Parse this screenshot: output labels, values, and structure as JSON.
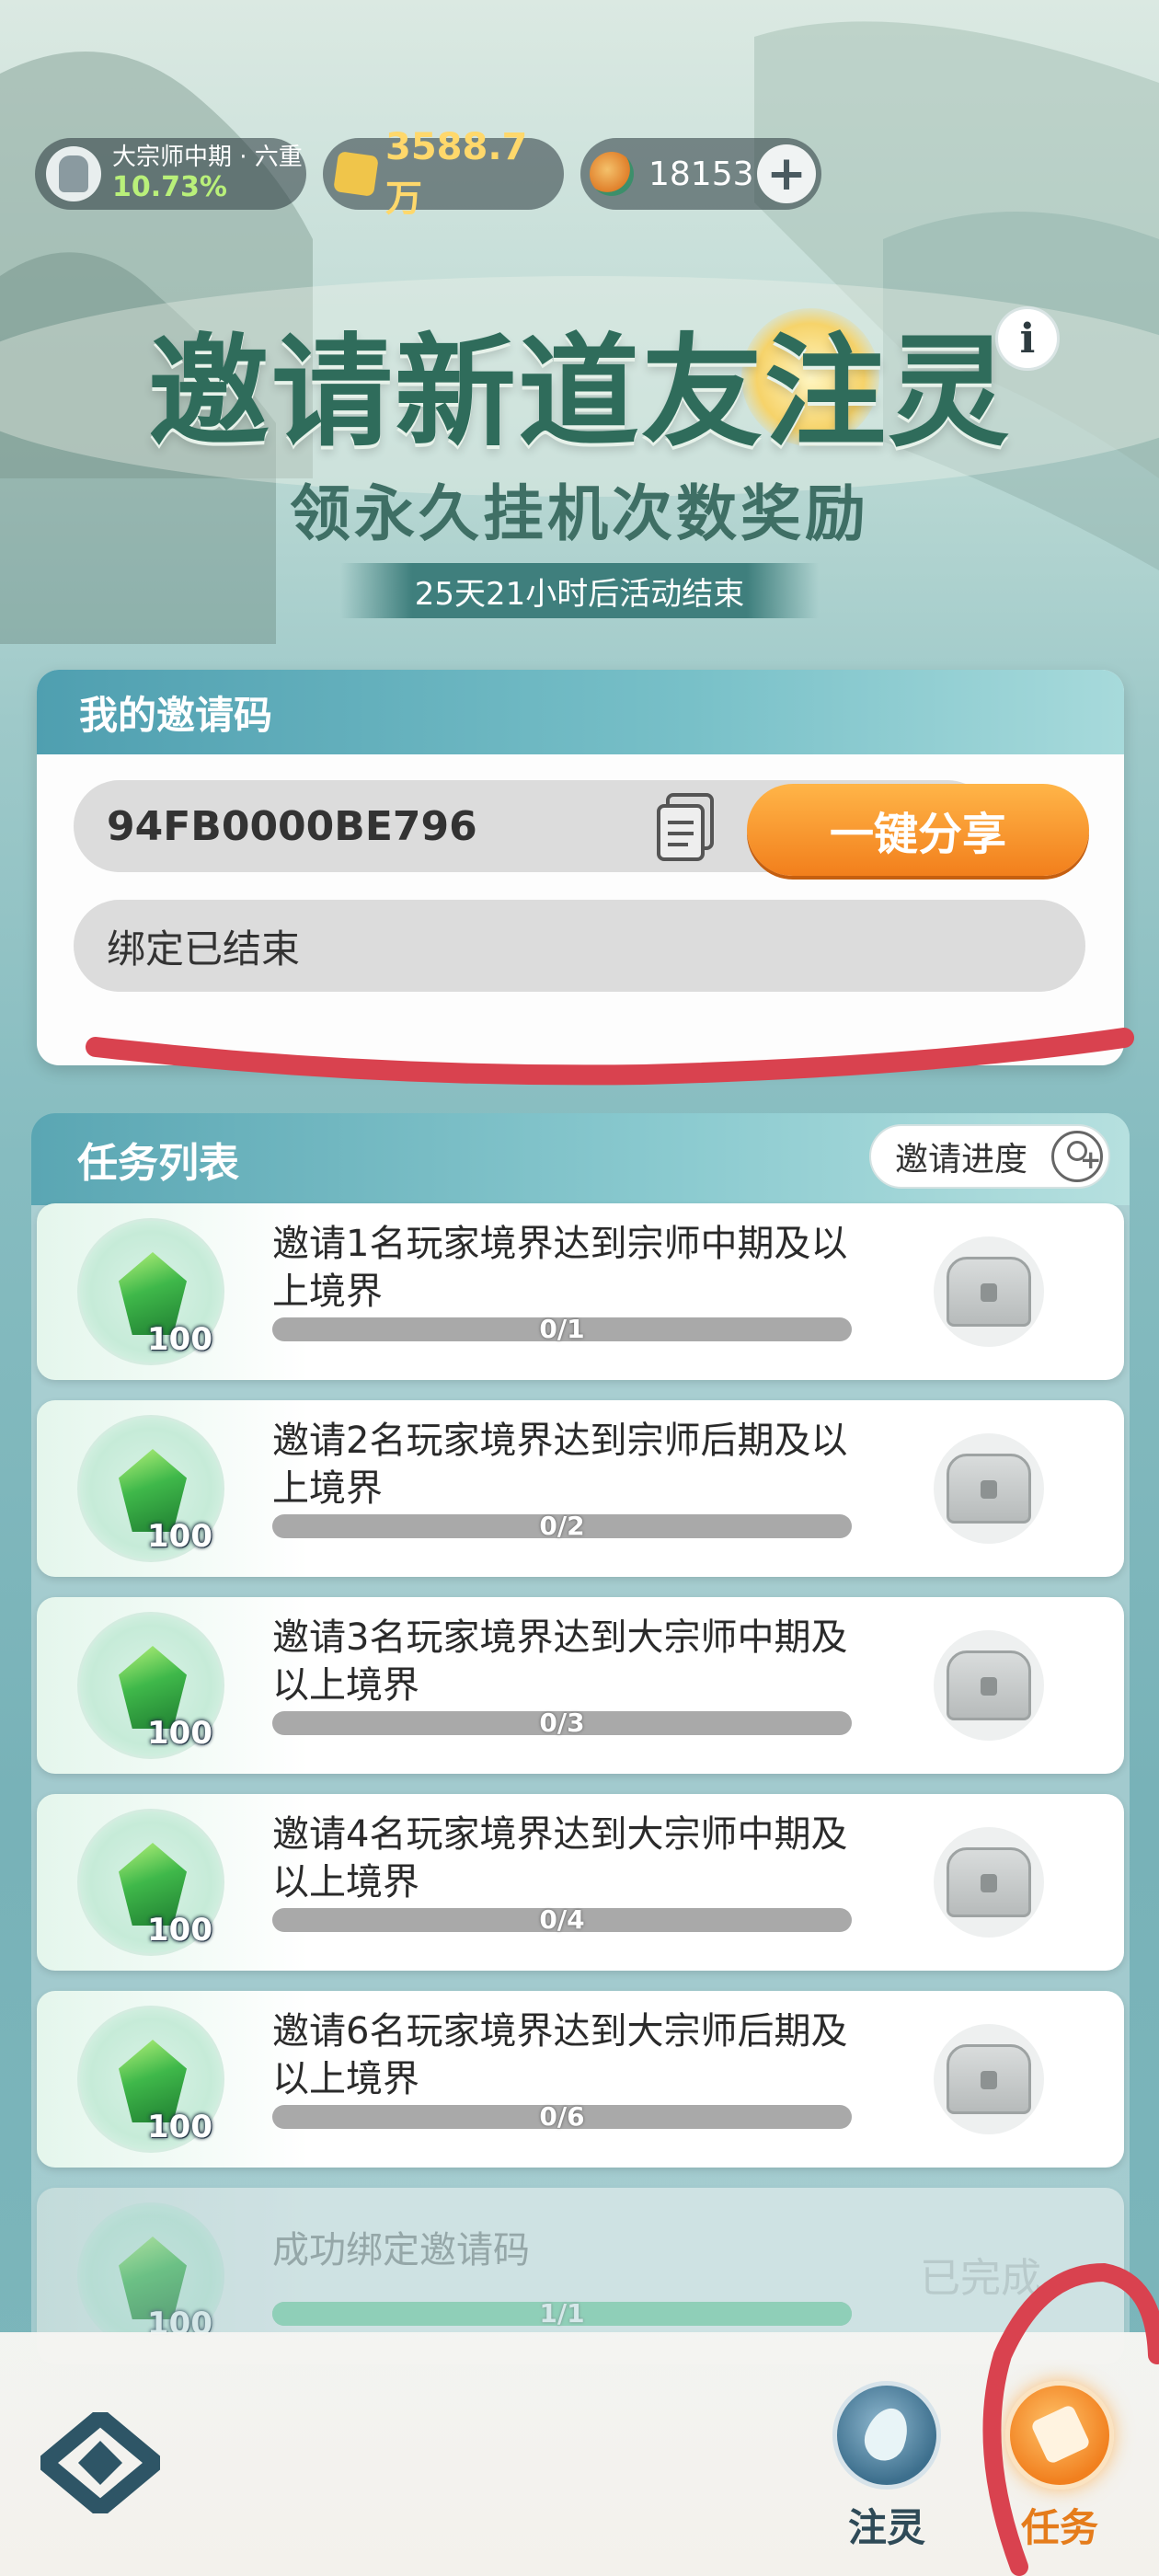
{
  "status_bar": {
    "rank_title": "大宗师中期 · 六重",
    "rank_percent": "10.73%",
    "gold_value": "3588.7万",
    "jade_value": "18153",
    "plus_label": "+"
  },
  "header": {
    "title": "邀请新道友注灵",
    "subtitle": "领永久挂机次数奖励",
    "countdown": "25天21小时后活动结束",
    "info_label": "i"
  },
  "invite": {
    "section_title": "我的邀请码",
    "code": "94FB0000BE796",
    "share_label": "一键分享",
    "bind_status": "绑定已结束"
  },
  "tasks": {
    "section_title": "任务列表",
    "progress_label": "邀请进度",
    "items": [
      {
        "text": "邀请1名玩家境界达到宗师中期及以上境界",
        "reward": "100",
        "progress": "0/1",
        "fraction": 0
      },
      {
        "text": "邀请2名玩家境界达到宗师后期及以上境界",
        "reward": "100",
        "progress": "0/2",
        "fraction": 0
      },
      {
        "text": "邀请3名玩家境界达到大宗师中期及以上境界",
        "reward": "100",
        "progress": "0/3",
        "fraction": 0
      },
      {
        "text": "邀请4名玩家境界达到大宗师中期及以上境界",
        "reward": "100",
        "progress": "0/4",
        "fraction": 0
      },
      {
        "text": "邀请6名玩家境界达到大宗师后期及以上境界",
        "reward": "100",
        "progress": "0/6",
        "fraction": 0
      },
      {
        "text": "成功绑定邀请码",
        "reward": "100",
        "progress": "1/1",
        "fraction": 1,
        "status": "已完成"
      }
    ]
  },
  "nav": {
    "spirit_label": "注灵",
    "task_label": "任务"
  },
  "colors": {
    "accent_orange": "#f27f1c",
    "teal_header": "#5aa6b3",
    "annotation_red": "#d9424f"
  }
}
